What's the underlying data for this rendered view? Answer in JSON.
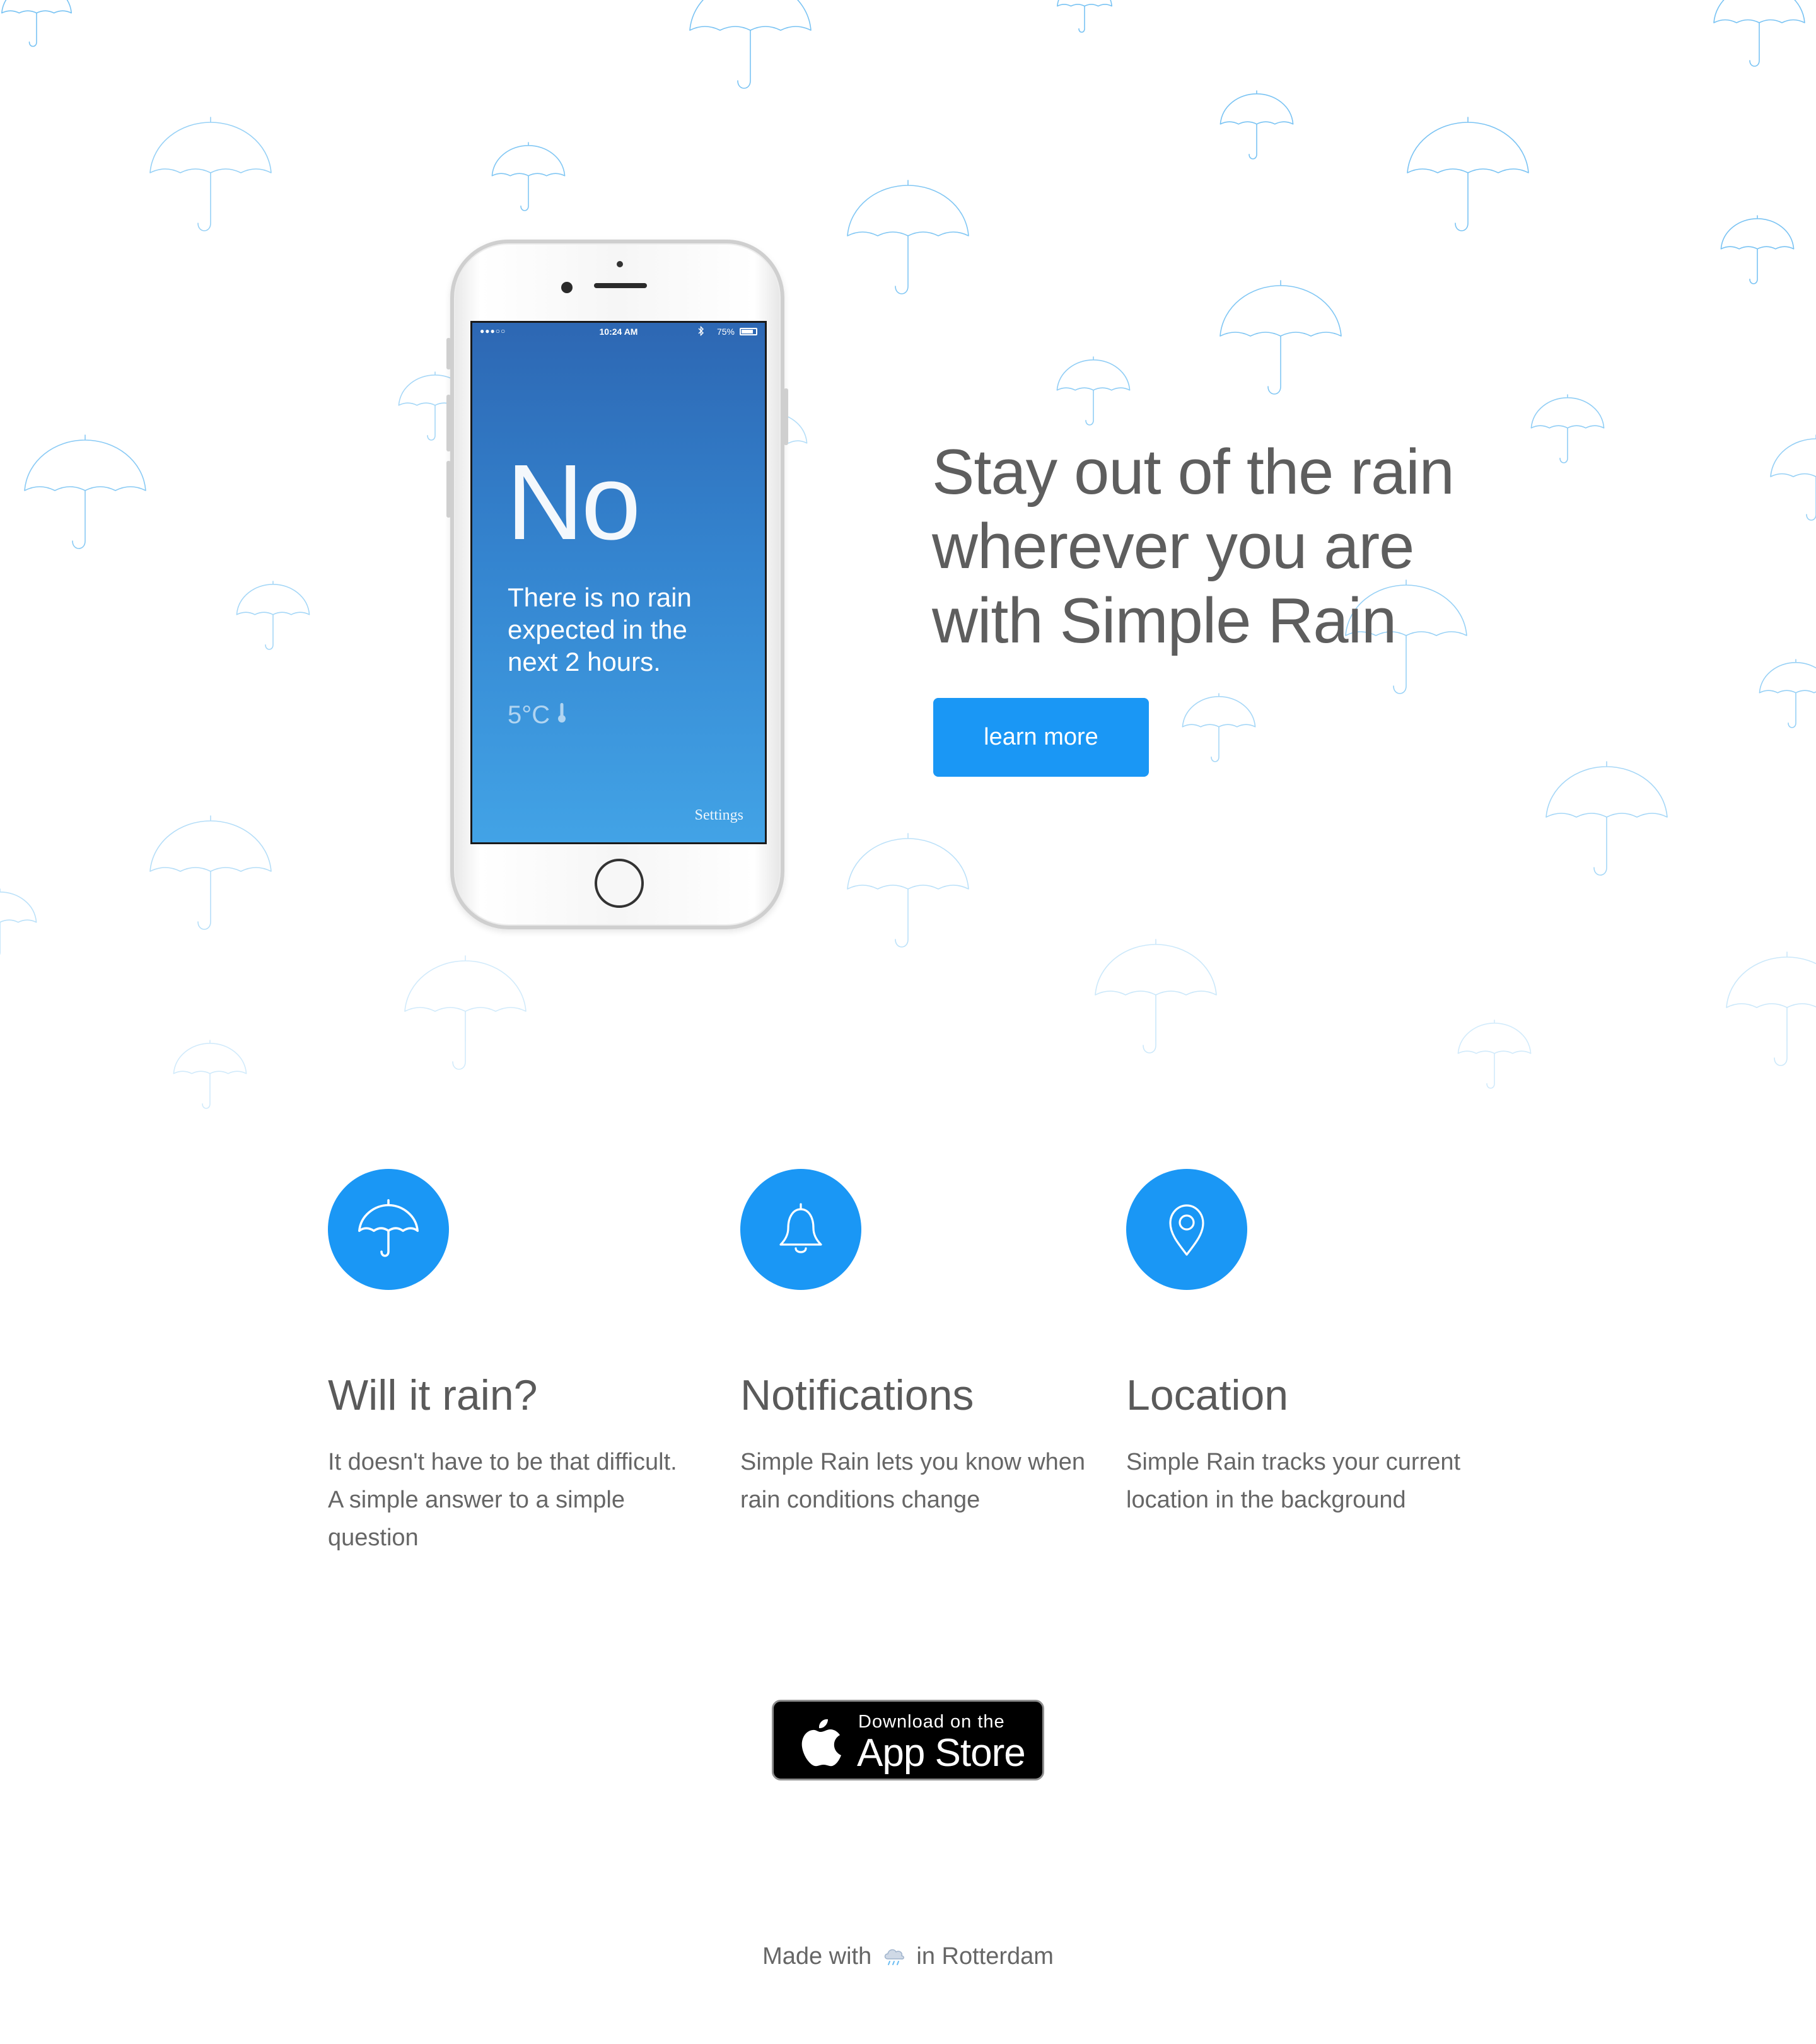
{
  "hero": {
    "headline_lines": [
      "Stay out of the rain",
      "wherever you are",
      "with Simple Rain"
    ],
    "cta_label": "learn more",
    "background_icon": "umbrella-icon"
  },
  "phone": {
    "status": {
      "signal": "●●●○○",
      "time": "10:24 AM",
      "battery": "75%"
    },
    "answer": "No",
    "detail": "There is no rain expected in the next 2 hours.",
    "temperature": "5°C",
    "temperature_icon": "thermometer-icon",
    "settings_label": "Settings"
  },
  "features": [
    {
      "icon": "umbrella-icon",
      "title": "Will it rain?",
      "text": "It doesn't have to be that difficult. A simple answer to a simple question"
    },
    {
      "icon": "bell-icon",
      "title": "Notifications",
      "text": "Simple Rain lets you know when rain conditions change"
    },
    {
      "icon": "location-pin-icon",
      "title": "Location",
      "text": "Simple Rain tracks your current location in the background"
    }
  ],
  "app_store": {
    "line1": "Download on the",
    "line2": "App Store",
    "icon": "apple-icon"
  },
  "footer": {
    "prefix": "Made with",
    "icon": "rain-cloud-icon",
    "suffix": "in Rotterdam"
  },
  "colors": {
    "accent": "#1a97f5",
    "umbrella": "#6bbdf2",
    "text": "#5e5e5e"
  }
}
